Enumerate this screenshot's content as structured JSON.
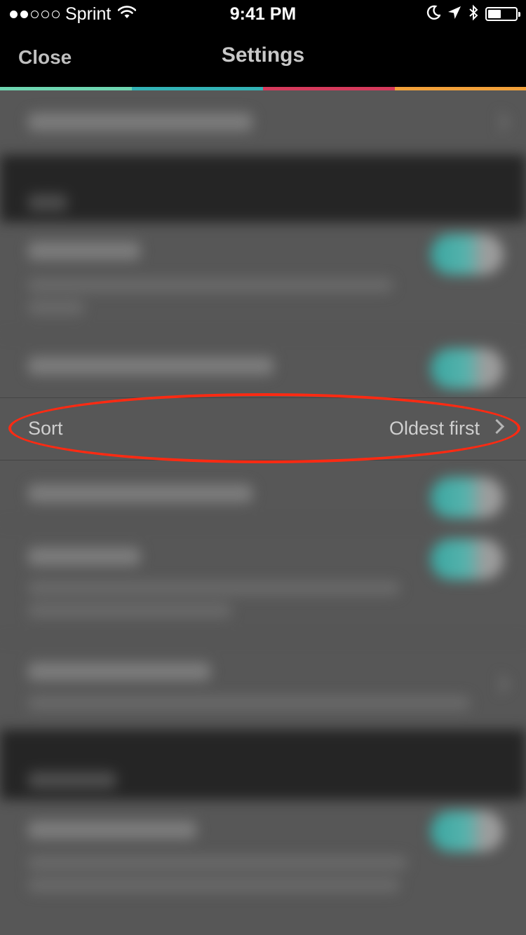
{
  "status_bar": {
    "signal_dots_filled": 2,
    "signal_dots_total": 5,
    "carrier": "Sprint",
    "time": "9:41 PM",
    "icons": [
      "wifi-icon",
      "moon-icon",
      "location-arrow-icon",
      "bluetooth-icon",
      "battery-icon"
    ],
    "battery_level": 0.4
  },
  "nav": {
    "close_label": "Close",
    "title": "Settings"
  },
  "stripe_colors": [
    "#6fd6b1",
    "#33b3b6",
    "#d63a5c",
    "#f2a13a"
  ],
  "sort_row": {
    "label": "Sort",
    "value": "Oldest first",
    "chevron_icon": "chevron-right-icon"
  },
  "annotation": {
    "color": "#ff2a12",
    "shape": "ellipse"
  },
  "colors": {
    "background": "#575757",
    "section_header": "#252525",
    "toggle_on": "#3aa6a0",
    "text_secondary": "#cfcfcf"
  }
}
